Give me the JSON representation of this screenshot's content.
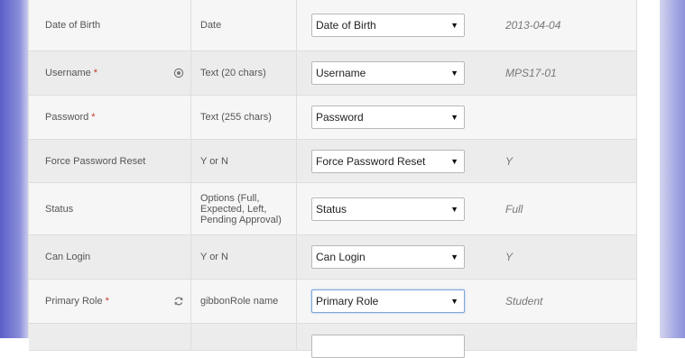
{
  "rows": [
    {
      "name": "Date of Birth",
      "required": false,
      "icon": null,
      "type": "Date",
      "select": "Date of Birth",
      "value": "2013-04-04"
    },
    {
      "name": "Username",
      "required": true,
      "icon": "target-icon",
      "type": "Text (20 chars)",
      "select": "Username",
      "value": "MPS17-01"
    },
    {
      "name": "Password",
      "required": true,
      "icon": null,
      "type": "Text (255 chars)",
      "select": "Password",
      "value": ""
    },
    {
      "name": "Force Password Reset",
      "required": false,
      "icon": null,
      "type": "Y or N",
      "select": "Force Password Reset",
      "value": "Y"
    },
    {
      "name": "Status",
      "required": false,
      "icon": null,
      "type": "Options (Full, Expected, Left, Pending Approval)",
      "select": "Status",
      "value": "Full"
    },
    {
      "name": "Can Login",
      "required": false,
      "icon": null,
      "type": "Y or N",
      "select": "Can Login",
      "value": "Y"
    },
    {
      "name": "Primary Role",
      "required": true,
      "icon": "refresh-icon",
      "type": "gibbonRole name",
      "select": "Primary Role",
      "value": "Student"
    }
  ],
  "required_marker": "*",
  "dropdown_arrow": "▼"
}
